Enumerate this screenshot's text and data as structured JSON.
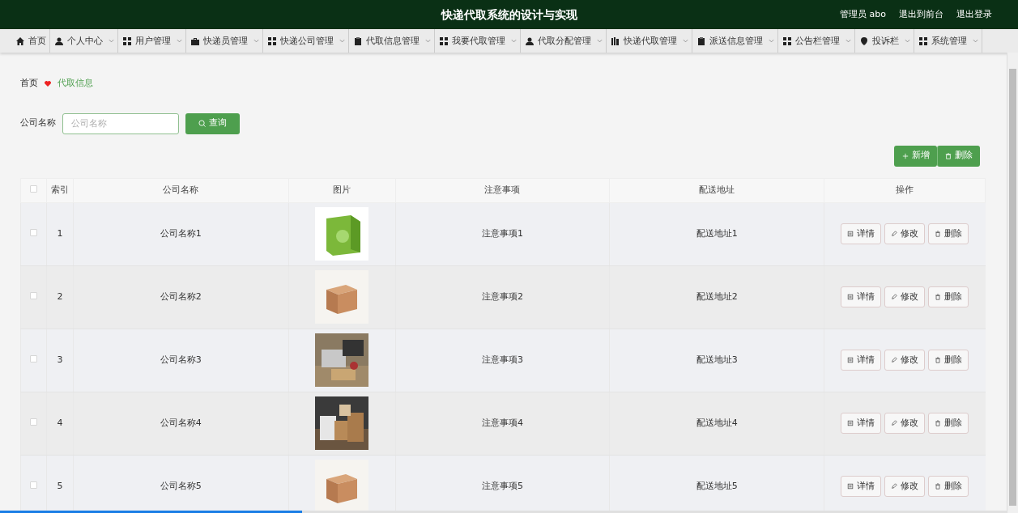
{
  "header": {
    "title": "快递代取系统的设计与实现",
    "user": "管理员 abo",
    "links": [
      "退出到前台",
      "退出登录"
    ]
  },
  "nav": [
    {
      "label": "首页",
      "dropdown": false
    },
    {
      "label": "个人中心",
      "dropdown": true
    },
    {
      "label": "用户管理",
      "dropdown": true
    },
    {
      "label": "快递员管理",
      "dropdown": true
    },
    {
      "label": "快递公司管理",
      "dropdown": true
    },
    {
      "label": "代取信息管理",
      "dropdown": true
    },
    {
      "label": "我要代取管理",
      "dropdown": true
    },
    {
      "label": "代取分配管理",
      "dropdown": true
    },
    {
      "label": "快递代取管理",
      "dropdown": true
    },
    {
      "label": "派送信息管理",
      "dropdown": true
    },
    {
      "label": "公告栏管理",
      "dropdown": true
    },
    {
      "label": "投诉栏",
      "dropdown": true
    },
    {
      "label": "系统管理",
      "dropdown": true
    }
  ],
  "breadcrumb": [
    "首页",
    "代取信息"
  ],
  "search": {
    "label": "公司名称",
    "placeholder": "公司名称",
    "button": "查询"
  },
  "actions": [
    "新增",
    "删除"
  ],
  "table": {
    "select_all_checked": false,
    "columns": [
      "索引",
      "公司名称",
      "图片",
      "注意事项",
      "配送地址",
      "操作"
    ],
    "rows": [
      {
        "index": "1",
        "name": "公司名称1",
        "notes": "注意事项1",
        "address": "配送地址1",
        "checked": false,
        "buttons": [
          "详情",
          "修改",
          "删除"
        ]
      },
      {
        "index": "2",
        "name": "公司名称2",
        "notes": "注意事项2",
        "address": "配送地址2",
        "checked": false,
        "buttons": [
          "详情",
          "修改",
          "删除"
        ]
      },
      {
        "index": "3",
        "name": "公司名称3",
        "notes": "注意事项3",
        "address": "配送地址3",
        "checked": false,
        "buttons": [
          "详情",
          "修改",
          "删除"
        ]
      },
      {
        "index": "4",
        "name": "公司名称4",
        "notes": "注意事项4",
        "address": "配送地址4",
        "checked": false,
        "buttons": [
          "详情",
          "修改",
          "删除"
        ]
      },
      {
        "index": "5",
        "name": "公司名称5",
        "notes": "注意事项5",
        "address": "配送地址5",
        "checked": false,
        "buttons": [
          "详情",
          "修改",
          "删除"
        ]
      }
    ]
  },
  "loading_bar": {
    "level": 0.3
  }
}
